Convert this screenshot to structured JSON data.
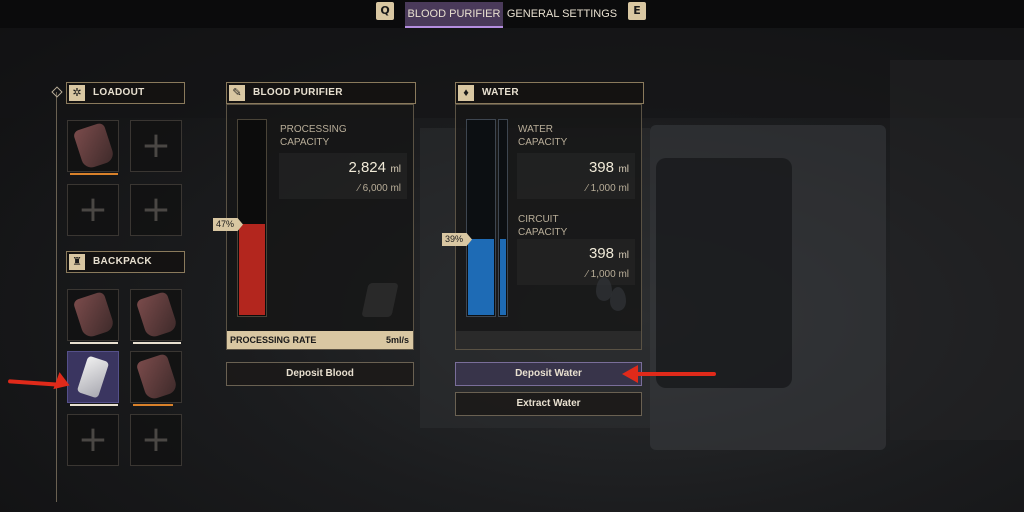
{
  "top_bar": {
    "key_left": "Q",
    "tab_active": "BLOOD PURIFIER",
    "tab_inactive": "GENERAL SETTINGS",
    "key_right": "E",
    "active_color": "#4a3a5a"
  },
  "loadout": {
    "title": "LOADOUT",
    "icon": "gear-icon",
    "slots": [
      "blood-bag",
      "empty",
      "empty",
      "empty"
    ]
  },
  "backpack": {
    "title": "BACKPACK",
    "icon": "backpack-icon",
    "slots": [
      "blood-bag",
      "blood-bag",
      "empty-blood-bag",
      "blood-bag",
      "empty",
      "empty"
    ]
  },
  "blood_purifier": {
    "title": "BLOOD PURIFIER",
    "icon": "blood-drop-icon",
    "capacity_label": "PROCESSING\nCAPACITY",
    "current_value": "2,824",
    "current_unit": "ml",
    "max_value": "⁄ 6,000 ml",
    "fill_percent_label": "47%",
    "fill_fraction": 0.47,
    "rate_label": "PROCESSING RATE",
    "rate_value": "5ml/s",
    "deposit_button": "Deposit Blood",
    "fill_color": "#b3261e"
  },
  "water": {
    "title": "WATER",
    "icon": "water-drop-icon",
    "capacity_label": "WATER\nCAPACITY",
    "capacity_value": "398",
    "capacity_unit": "ml",
    "capacity_max": "⁄ 1,000 ml",
    "circuit_label": "CIRCUIT\nCAPACITY",
    "circuit_value": "398",
    "circuit_unit": "ml",
    "circuit_max": "⁄ 1,000 ml",
    "fill_percent_label": "39%",
    "fill_fraction": 0.39,
    "deposit_button": "Deposit Water",
    "extract_button": "Extract Water",
    "fill_color": "#1e6bb5"
  },
  "annotations": {
    "arrow_color": "#e02a1a"
  }
}
